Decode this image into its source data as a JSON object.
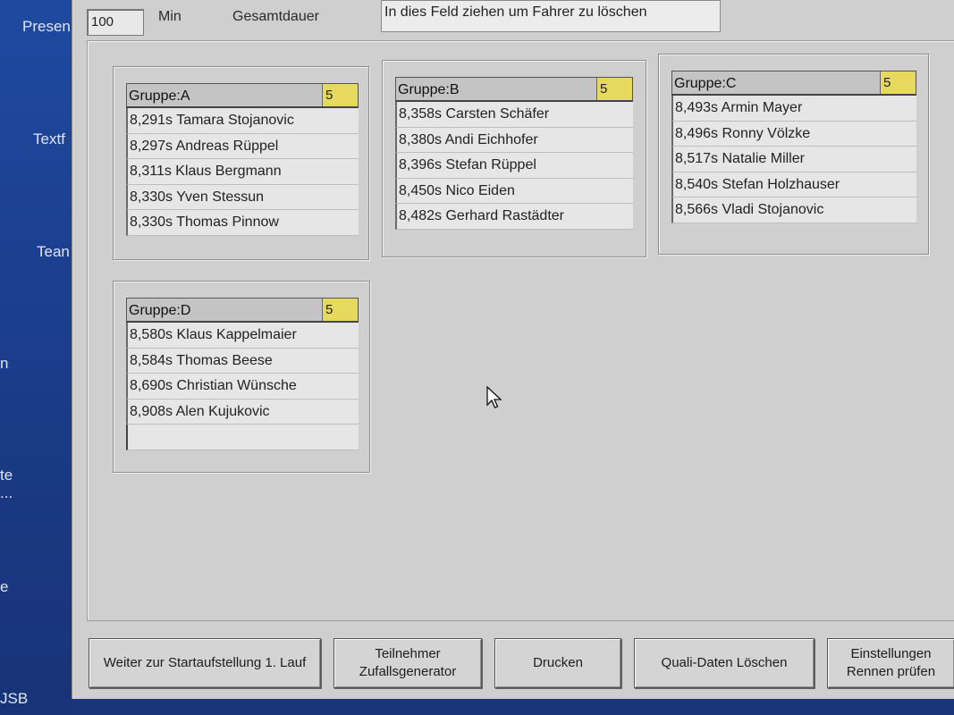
{
  "desktop": {
    "icons": [
      "Presen",
      "Textf",
      "Tean",
      "n",
      "te",
      "...",
      "e",
      "JSB"
    ]
  },
  "toolbar": {
    "duration_value": "100",
    "unit_label": "Min",
    "total_label": "Gesamtdauer",
    "drop_field_text": "In dies Feld ziehen um Fahrer zu löschen"
  },
  "groups": [
    {
      "title": "Gruppe:A",
      "count": "5",
      "rows": [
        "8,291s Tamara Stojanovic",
        "8,297s Andreas Rüppel",
        "8,311s Klaus Bergmann",
        "8,330s Yven Stessun",
        "8,330s Thomas Pinnow"
      ]
    },
    {
      "title": "Gruppe:B",
      "count": "5",
      "rows": [
        "8,358s Carsten Schäfer",
        "8,380s Andi Eichhofer",
        "8,396s Stefan Rüppel",
        "8,450s Nico Eiden",
        "8,482s Gerhard Rastädter"
      ]
    },
    {
      "title": "Gruppe:C",
      "count": "5",
      "rows": [
        "8,493s Armin Mayer",
        "8,496s Ronny Völzke",
        "8,517s Natalie Miller",
        "8,540s Stefan Holzhauser",
        "8,566s Vladi Stojanovic"
      ]
    },
    {
      "title": "Gruppe:D",
      "count": "5",
      "rows": [
        "8,580s Klaus Kappelmaier",
        "8,584s Thomas Beese",
        "8,690s Christian Wünsche",
        "8,908s Alen Kujukovic",
        ""
      ]
    }
  ],
  "buttons": {
    "start_grid": "Weiter zur Startaufstellung 1. Lauf",
    "random_gen": "Teilnehmer\nZufallsgenerator",
    "print": "Drucken",
    "delete_quali": "Quali-Daten Löschen",
    "settings": "Einstellungen\nRennen prüfen"
  }
}
